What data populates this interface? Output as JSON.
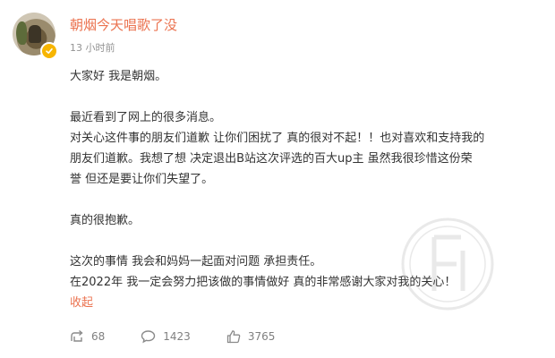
{
  "post": {
    "username": "朝烟今天唱歌了没",
    "timestamp": "13 小时前",
    "avatar_icon": "user-avatar-photo",
    "verified_icon": "verified-badge-icon",
    "content_lines": [
      "大家好 我是朝烟。",
      "",
      "最近看到了网上的很多消息。",
      "对关心这件事的朋友们道歉 让你们困扰了 真的很对不起！！也对喜欢和支持我的",
      "朋友们道歉。我想了想 决定退出B站这次评选的百大up主 虽然我很珍惜这份荣",
      "誉 但还是要让你们失望了。",
      "",
      "真的很抱歉。",
      "",
      "这次的事情  我会和妈妈一起面对问题 承担责任。",
      "在2022年 我一定会努力把该做的事情做好 真的非常感谢大家对我的关心！"
    ],
    "collapse_label": "收起",
    "link_color": "#eb7350"
  },
  "actions": {
    "repost": {
      "icon": "repost-icon",
      "count": "68"
    },
    "comment": {
      "icon": "comment-icon",
      "count": "1423"
    },
    "like": {
      "icon": "thumbs-up-icon",
      "count": "3765"
    }
  }
}
